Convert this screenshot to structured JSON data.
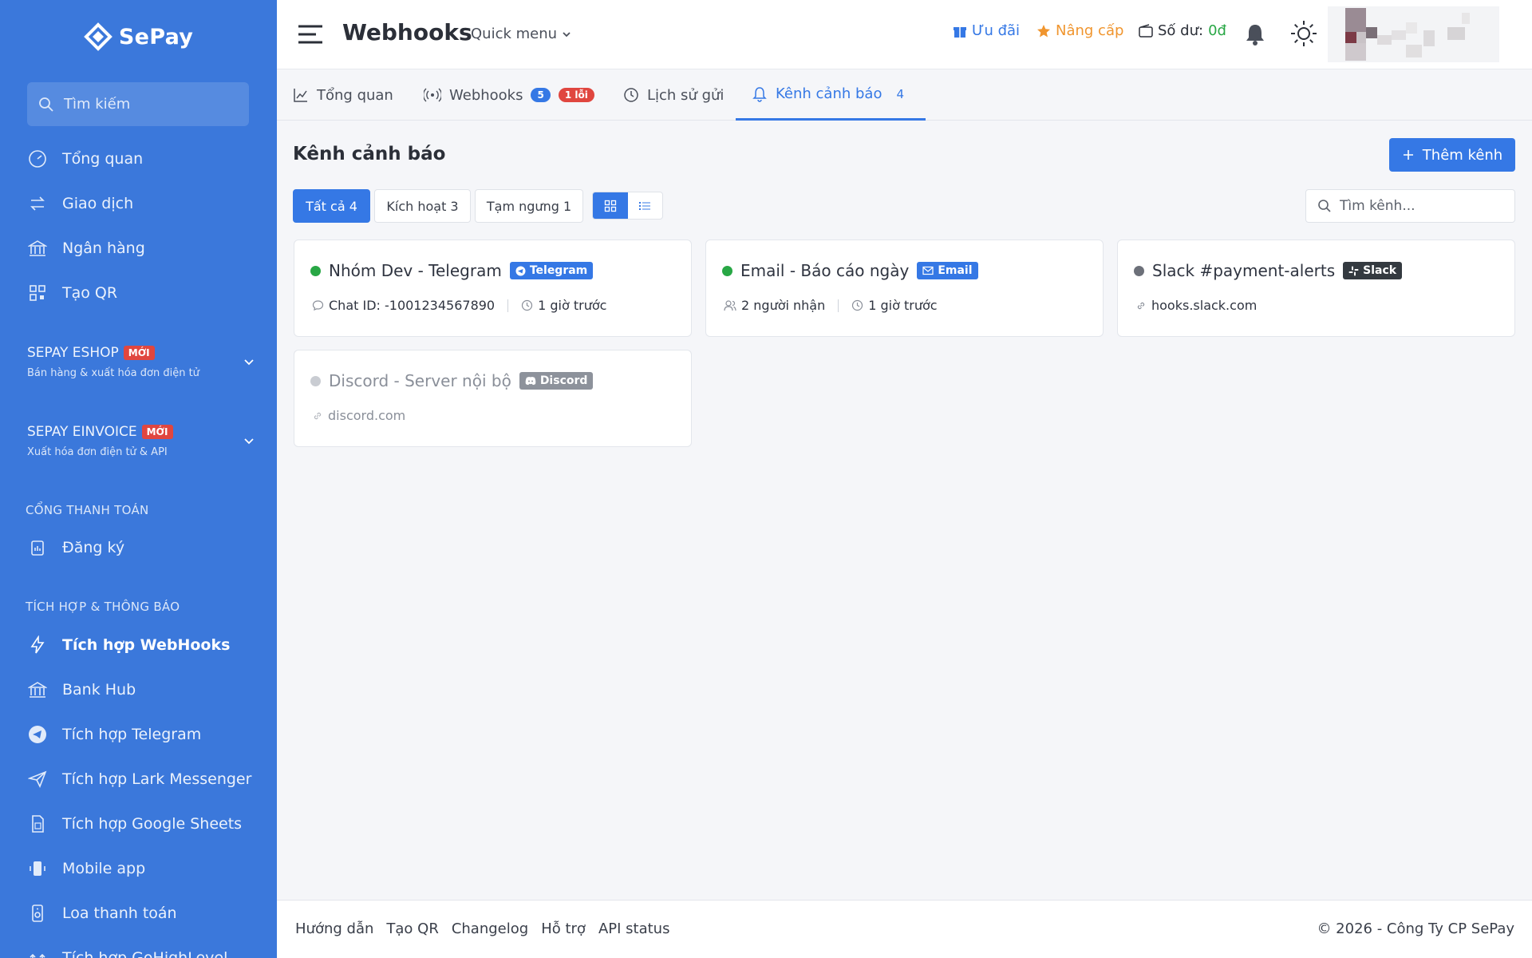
{
  "app": {
    "name": "SePay"
  },
  "sidebar": {
    "search_placeholder": "Tìm kiếm",
    "items": [
      {
        "label": "Tổng quan"
      },
      {
        "label": "Giao dịch"
      },
      {
        "label": "Ngân hàng"
      },
      {
        "label": "Tạo QR"
      }
    ],
    "groups": [
      {
        "title": "SEPAY ESHOP",
        "badge": "MỚI",
        "subtitle": "Bán hàng & xuất hóa đơn điện tử"
      },
      {
        "title": "SEPAY EINVOICE",
        "badge": "MỚI",
        "subtitle": "Xuất hóa đơn điện tử & API"
      }
    ],
    "section_payment": "CỔNG THANH TOÁN",
    "payment_items": [
      {
        "label": "Đăng ký"
      }
    ],
    "section_integration": "TÍCH HỢP & THÔNG BÁO",
    "integration_items": [
      {
        "label": "Tích hợp WebHooks",
        "active": true
      },
      {
        "label": "Bank Hub"
      },
      {
        "label": "Tích hợp Telegram"
      },
      {
        "label": "Tích hợp Lark Messenger"
      },
      {
        "label": "Tích hợp Google Sheets"
      },
      {
        "label": "Mobile app"
      },
      {
        "label": "Loa thanh toán"
      },
      {
        "label": "Tích hợp GoHighLevel"
      }
    ]
  },
  "topbar": {
    "title": "Webhooks",
    "quick_menu": "Quick menu",
    "promo": "Ưu đãi",
    "upgrade": "Nâng cấp",
    "balance_label": "Số dư:",
    "balance_value": "0đ"
  },
  "tabs": [
    {
      "label": "Tổng quan"
    },
    {
      "label": "Webhooks",
      "count": "5",
      "error": "1 lỗi"
    },
    {
      "label": "Lịch sử gửi"
    },
    {
      "label": "Kênh cảnh báo",
      "count": "4",
      "active": true
    }
  ],
  "main": {
    "title": "Kênh cảnh báo",
    "add_button": "Thêm kênh",
    "filters": [
      {
        "label": "Tất cả 4",
        "active": true
      },
      {
        "label": "Kích hoạt 3"
      },
      {
        "label": "Tạm ngưng 1"
      }
    ],
    "search_placeholder": "Tìm kênh..."
  },
  "channels": [
    {
      "name": "Nhóm Dev - Telegram",
      "type": "Telegram",
      "type_color": "#3578e5",
      "status": "active",
      "detail": "Chat ID: -1001234567890",
      "time": "1 giờ trước"
    },
    {
      "name": "Email - Báo cáo ngày",
      "type": "Email",
      "type_color": "#3578e5",
      "status": "active",
      "detail": "2 người nhận",
      "time": "1 giờ trước"
    },
    {
      "name": "Slack #payment-alerts",
      "type": "Slack",
      "type_color": "#343a40",
      "status": "unknown",
      "detail": "hooks.slack.com"
    },
    {
      "name": "Discord - Server nội bộ",
      "type": "Discord",
      "type_color": "#8d929b",
      "status": "paused",
      "detail": "discord.com"
    }
  ],
  "colors": {
    "sidebar": "#3b78db",
    "accent": "#3578e5",
    "active_dot": "#28a745",
    "error": "#e0463f",
    "upgrade": "#f0952e",
    "balance": "#28a745"
  },
  "footer": {
    "links": [
      "Hướng dẫn",
      "Tạo QR",
      "Changelog",
      "Hỗ trợ",
      "API status"
    ],
    "copyright": "© 2026 - Công Ty CP SePay"
  }
}
